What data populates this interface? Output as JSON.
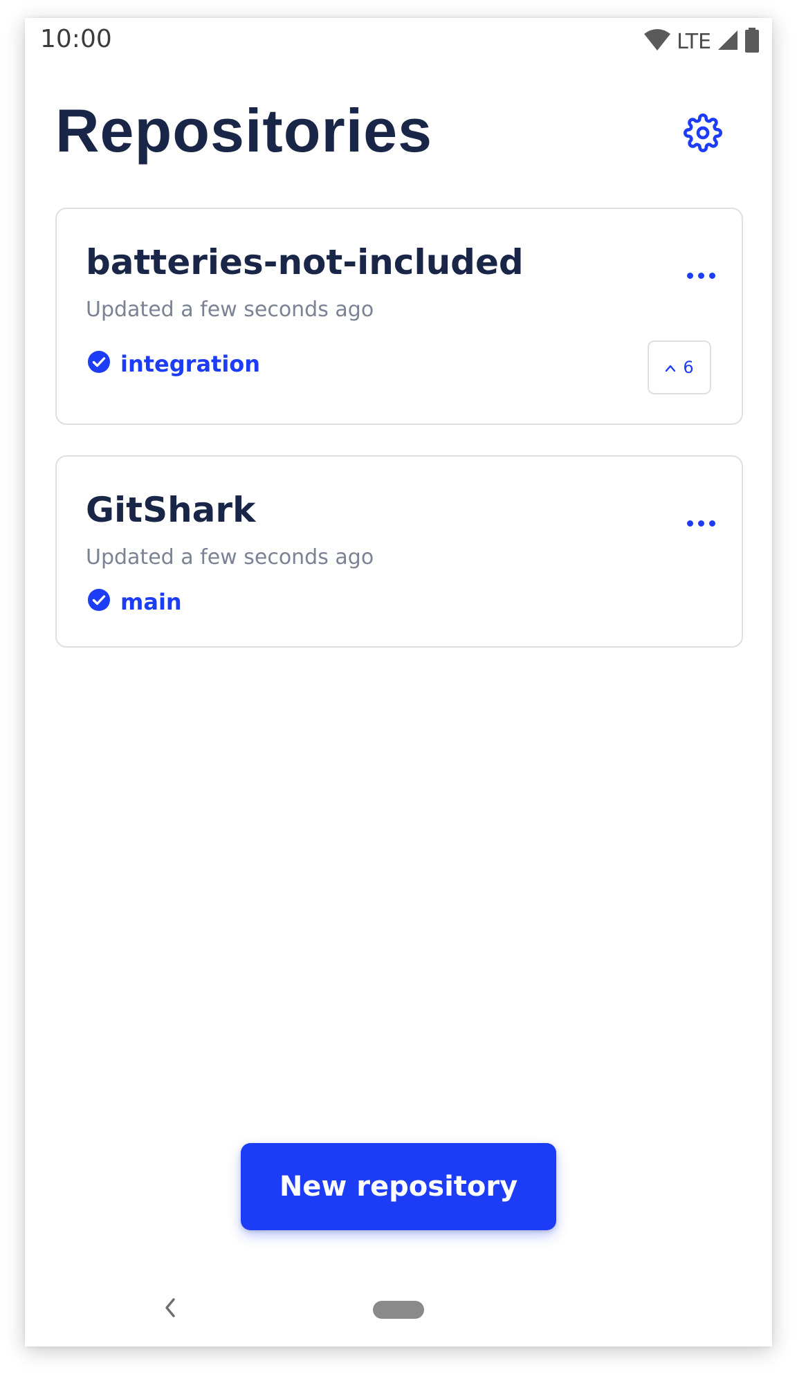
{
  "status_bar": {
    "time": "10:00",
    "network": "LTE",
    "icons": [
      "wifi-icon",
      "signal-icon",
      "battery-icon"
    ]
  },
  "header": {
    "title": "Repositories",
    "settings_icon": "gear-icon"
  },
  "repositories": [
    {
      "name": "batteries-not-included",
      "updated": "Updated a few seconds ago",
      "branch": "integration",
      "branch_icon": "check-circle-icon",
      "menu_icon": "more-horizontal-icon",
      "commits_ahead": "6",
      "commits_icon": "chevron-up-icon"
    },
    {
      "name": "GitShark",
      "updated": "Updated a few seconds ago",
      "branch": "main",
      "branch_icon": "check-circle-icon",
      "menu_icon": "more-horizontal-icon"
    }
  ],
  "fab": {
    "label": "New repository"
  },
  "navigation": {
    "back_icon": "back-chevron-icon",
    "home_icon": "home-pill-icon"
  },
  "colors": {
    "accent": "#1d3cf5",
    "title": "#1a2647",
    "muted": "#7a8293",
    "border": "#dddfe3"
  }
}
